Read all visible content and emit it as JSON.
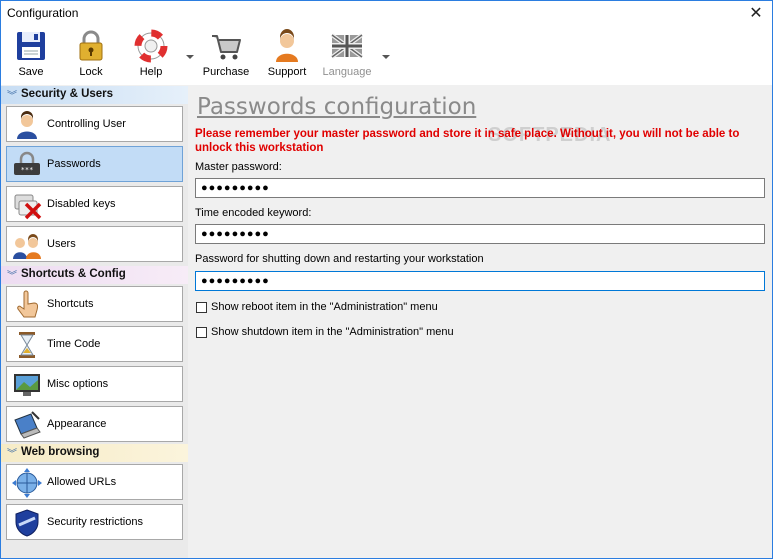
{
  "window": {
    "title": "Configuration",
    "close_glyph": "✕"
  },
  "toolbar": {
    "save": "Save",
    "lock": "Lock",
    "help": "Help",
    "purchase": "Purchase",
    "support": "Support",
    "language": "Language"
  },
  "sidebar": {
    "groups": [
      {
        "title": "Security & Users",
        "items": [
          "Controlling User",
          "Passwords",
          "Disabled keys",
          "Users"
        ]
      },
      {
        "title": "Shortcuts & Config",
        "items": [
          "Shortcuts",
          "Time Code",
          "Misc options",
          "Appearance"
        ]
      },
      {
        "title": "Web browsing",
        "items": [
          "Allowed URLs",
          "Security restrictions"
        ]
      }
    ],
    "active_item": "Passwords"
  },
  "main": {
    "title": "Passwords configuration",
    "warning": "Please remember your master password and store it in safe place. Without it, you will not be able to unlock this workstation",
    "watermark": "SOFTPEDIA",
    "fields": [
      {
        "label": "Master password:",
        "value": "●●●●●●●●●"
      },
      {
        "label": "Time encoded keyword:",
        "value": "●●●●●●●●●"
      },
      {
        "label": "Password for shutting down and restarting your workstation",
        "value": "●●●●●●●●●"
      }
    ],
    "checkboxes": [
      {
        "label": "Show reboot item in the \"Administration\" menu",
        "checked": false
      },
      {
        "label": "Show shutdown item in the \"Administration\" menu",
        "checked": false
      }
    ]
  },
  "colors": {
    "warning": "#e00000",
    "active_item": "#c2dcf6",
    "title": "#8a8a8a"
  }
}
